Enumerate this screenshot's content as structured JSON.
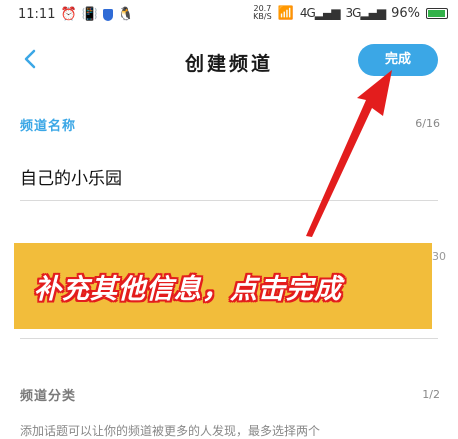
{
  "status_bar": {
    "time": "11:11",
    "speed_value": "20.7",
    "speed_unit": "KB/S",
    "network_1": "4G",
    "network_2": "3G",
    "battery": "96%"
  },
  "nav": {
    "title": "创建频道",
    "done_label": "完成"
  },
  "channel_name": {
    "label": "频道名称",
    "counter": "6/16",
    "value": "自己的小乐园"
  },
  "obscured_counter_peek": "30",
  "overlay": {
    "text": "补充其他信息，点击完成"
  },
  "category": {
    "label": "频道分类",
    "counter": "1/2",
    "hint": "添加话题可以让你的频道被更多的人发现，最多选择两个"
  },
  "colors": {
    "accent": "#3ba7e6",
    "annotation_red": "#e31d1d",
    "overlay_bg": "#f2bd3b"
  }
}
